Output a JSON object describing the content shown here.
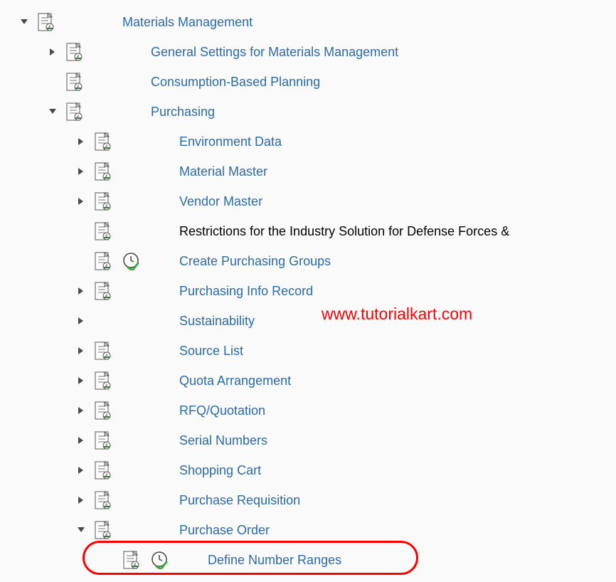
{
  "watermark": "www.tutorialkart.com",
  "tree": {
    "root": {
      "label": "Materials Management",
      "expanded": true
    },
    "level1": [
      {
        "label": "General Settings for Materials Management",
        "type": "collapsed"
      },
      {
        "label": "Consumption-Based Planning",
        "type": "leaf"
      },
      {
        "label": "Purchasing",
        "type": "expanded"
      }
    ],
    "purchasing": [
      {
        "label": "Environment Data",
        "type": "collapsed",
        "doc": true
      },
      {
        "label": "Material Master",
        "type": "collapsed",
        "doc": true
      },
      {
        "label": "Vendor Master",
        "type": "collapsed",
        "doc": true
      },
      {
        "label": "Restrictions for the Industry Solution for Defense Forces &",
        "type": "leaf-black",
        "doc": true
      },
      {
        "label": "Create Purchasing Groups",
        "type": "activity",
        "doc": true,
        "clock": true
      },
      {
        "label": "Purchasing Info Record",
        "type": "collapsed",
        "doc": true
      },
      {
        "label": "Sustainability",
        "type": "collapsed",
        "doc": false
      },
      {
        "label": "Source List",
        "type": "collapsed",
        "doc": true
      },
      {
        "label": "Quota Arrangement",
        "type": "collapsed",
        "doc": true
      },
      {
        "label": "RFQ/Quotation",
        "type": "collapsed",
        "doc": true
      },
      {
        "label": "Serial Numbers",
        "type": "collapsed",
        "doc": true
      },
      {
        "label": "Shopping Cart",
        "type": "collapsed",
        "doc": true
      },
      {
        "label": "Purchase Requisition",
        "type": "collapsed",
        "doc": true
      },
      {
        "label": "Purchase Order",
        "type": "expanded",
        "doc": true
      }
    ],
    "po_children": [
      {
        "label": "Define Number Ranges",
        "type": "activity",
        "doc": true,
        "clock": true
      }
    ]
  }
}
